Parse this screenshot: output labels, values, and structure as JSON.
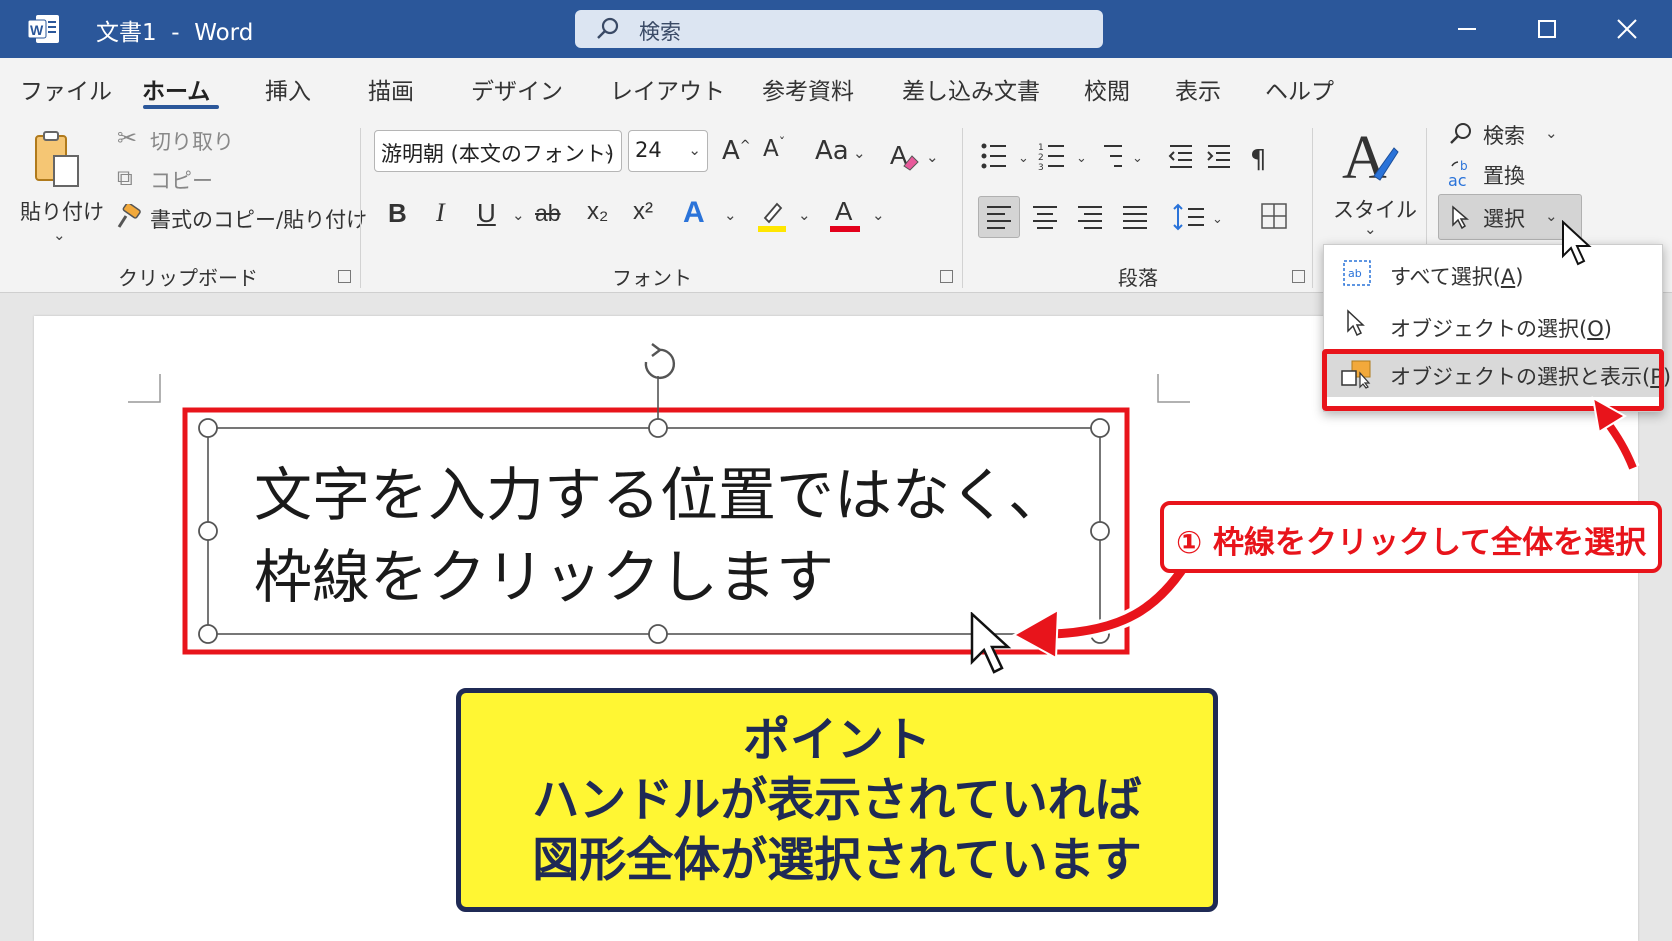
{
  "window": {
    "doc_name": "文書1",
    "separator": "-",
    "app_name": "Word",
    "search_placeholder": "検索"
  },
  "tabs": [
    {
      "label": "ファイル"
    },
    {
      "label": "ホーム",
      "active": true
    },
    {
      "label": "挿入"
    },
    {
      "label": "描画"
    },
    {
      "label": "デザイン"
    },
    {
      "label": "レイアウト"
    },
    {
      "label": "参考資料"
    },
    {
      "label": "差し込み文書"
    },
    {
      "label": "校閲"
    },
    {
      "label": "表示"
    },
    {
      "label": "ヘルプ"
    }
  ],
  "clipboard": {
    "paste": "貼り付け",
    "cut": "切り取り",
    "copy": "コピー",
    "format_painter": "書式のコピー/貼り付け",
    "label": "クリップボード"
  },
  "font": {
    "name": "游明朝 (本文のフォント)",
    "size": "24",
    "grow": "A",
    "shrink": "A",
    "change_case": "Aa",
    "bold": "B",
    "italic": "I",
    "underline": "U",
    "strike": "ab",
    "subscript": "x₂",
    "superscript": "x²",
    "effects": "A",
    "font_color": "A",
    "label": "フォント",
    "highlight_color": "#ffe600",
    "font_color_bar": "#e3001b",
    "effects_color": "#2a73d9"
  },
  "paragraph": {
    "label": "段落"
  },
  "styles": {
    "label": "スタイル"
  },
  "editing": {
    "find": "検索",
    "replace": "置換",
    "select": "選択"
  },
  "select_menu": [
    {
      "label": "すべて選択(",
      "key": "A",
      "suffix": ")"
    },
    {
      "label": "オブジェクトの選択(",
      "key": "O",
      "suffix": ")"
    },
    {
      "label": "オブジェクトの選択と表示(",
      "key": "P",
      "suffix": ")",
      "highlighted": true
    }
  ],
  "textbox": {
    "line1": "文字を入力する位置ではなく、",
    "line2": "枠線をクリックします"
  },
  "callout": {
    "number": "①",
    "text": "枠線をクリックして全体を選択"
  },
  "point_box": {
    "line1": "ポイント",
    "line2": "ハンドルが表示されていれば",
    "line3": "図形全体が選択されています"
  },
  "colors": {
    "titlebar": "#2b579a",
    "accent_red": "#e8141b",
    "point_bg": "#fff633",
    "point_text": "#1f2a55"
  }
}
